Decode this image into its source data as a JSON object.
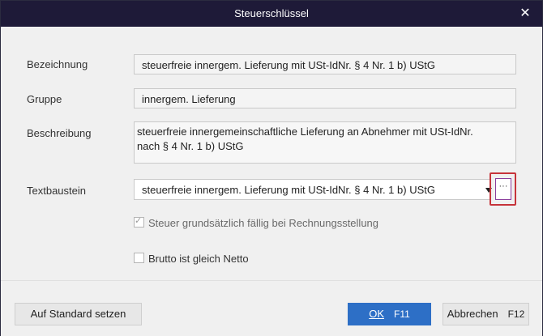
{
  "window": {
    "title": "Steuerschlüssel",
    "close_glyph": "✕"
  },
  "form": {
    "bezeichnung_label": "Bezeichnung",
    "bezeichnung_value": "steuerfreie innergem. Lieferung mit USt-IdNr. § 4 Nr. 1 b) UStG",
    "gruppe_label": "Gruppe",
    "gruppe_value": "innergem. Lieferung",
    "beschreibung_label": "Beschreibung",
    "beschreibung_value": "steuerfreie innergemeinschaftliche Lieferung an Abnehmer mit USt-IdNr. nach § 4 Nr. 1 b) UStG",
    "textbaustein_label": "Textbaustein",
    "textbaustein_value": "steuerfreie innergem. Lieferung mit USt-IdNr. § 4 Nr. 1 b) UStG",
    "ellipsis_label": "···",
    "checkbox_steuer_label": "Steuer grundsätzlich fällig bei Rechnungsstellung",
    "checkbox_steuer_checked": true,
    "checkbox_brutto_label": "Brutto ist gleich Netto",
    "checkbox_brutto_checked": false
  },
  "footer": {
    "default_button": "Auf Standard setzen",
    "ok_button": "OK",
    "ok_key": "F11",
    "cancel_button": "Abbrechen",
    "cancel_key": "F12"
  },
  "colors": {
    "titlebar": "#1e1a38",
    "primary": "#2d6fc6",
    "highlight": "#c6333a"
  }
}
